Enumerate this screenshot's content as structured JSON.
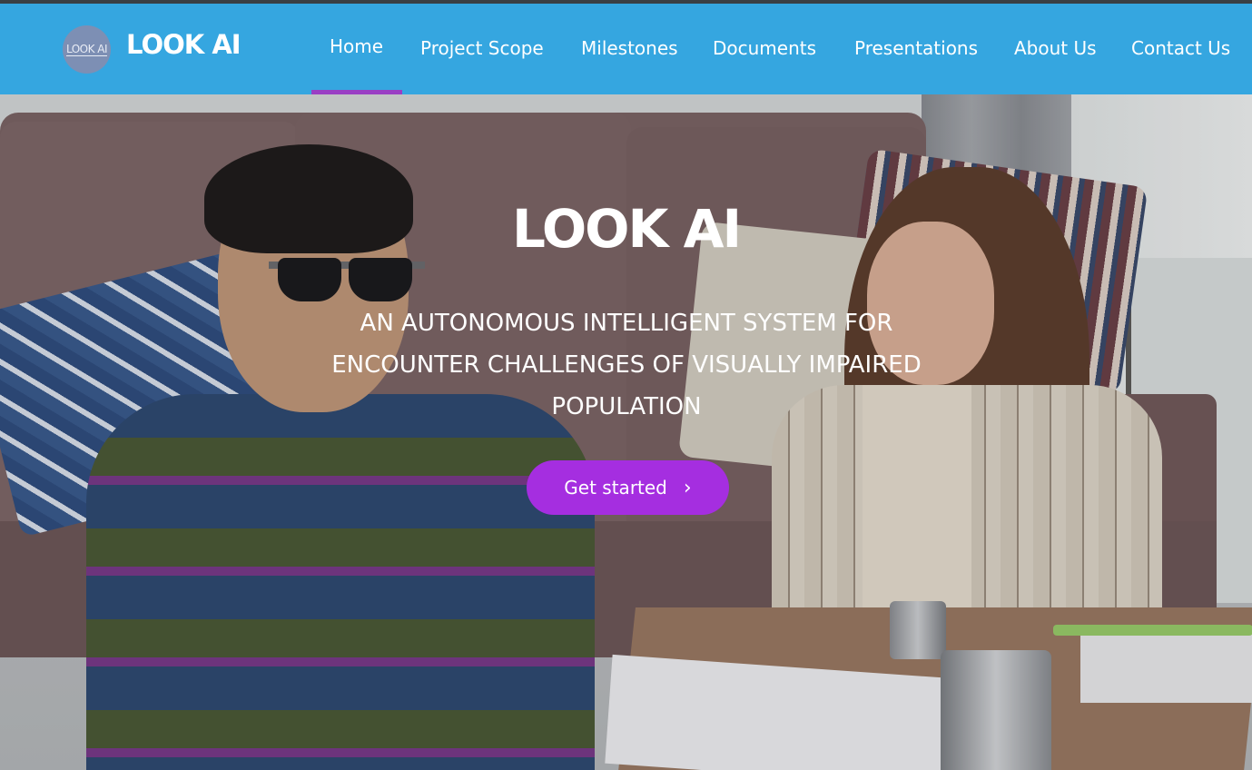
{
  "header": {
    "logo_text": "LOOK AI",
    "brand": "LOOK AI",
    "accent_color": "#35a6e0",
    "active_underline_color": "#9a3fc4"
  },
  "nav": {
    "items": [
      {
        "label": "Home",
        "active": true
      },
      {
        "label": "Project Scope"
      },
      {
        "label": "Milestones"
      },
      {
        "label": "Documents"
      },
      {
        "label": "Presentations"
      },
      {
        "label": "About Us"
      },
      {
        "label": "Contact Us"
      }
    ]
  },
  "hero": {
    "title": "LOOK AI",
    "subtitle": "AN AUTONOMOUS INTELLIGENT SYSTEM FOR ENCOUNTER CHALLENGES OF VISUALLY IMPAIRED POPULATION",
    "cta_label": "Get started",
    "cta_icon": "chevron-right-icon",
    "cta_color": "#a52ee0"
  }
}
